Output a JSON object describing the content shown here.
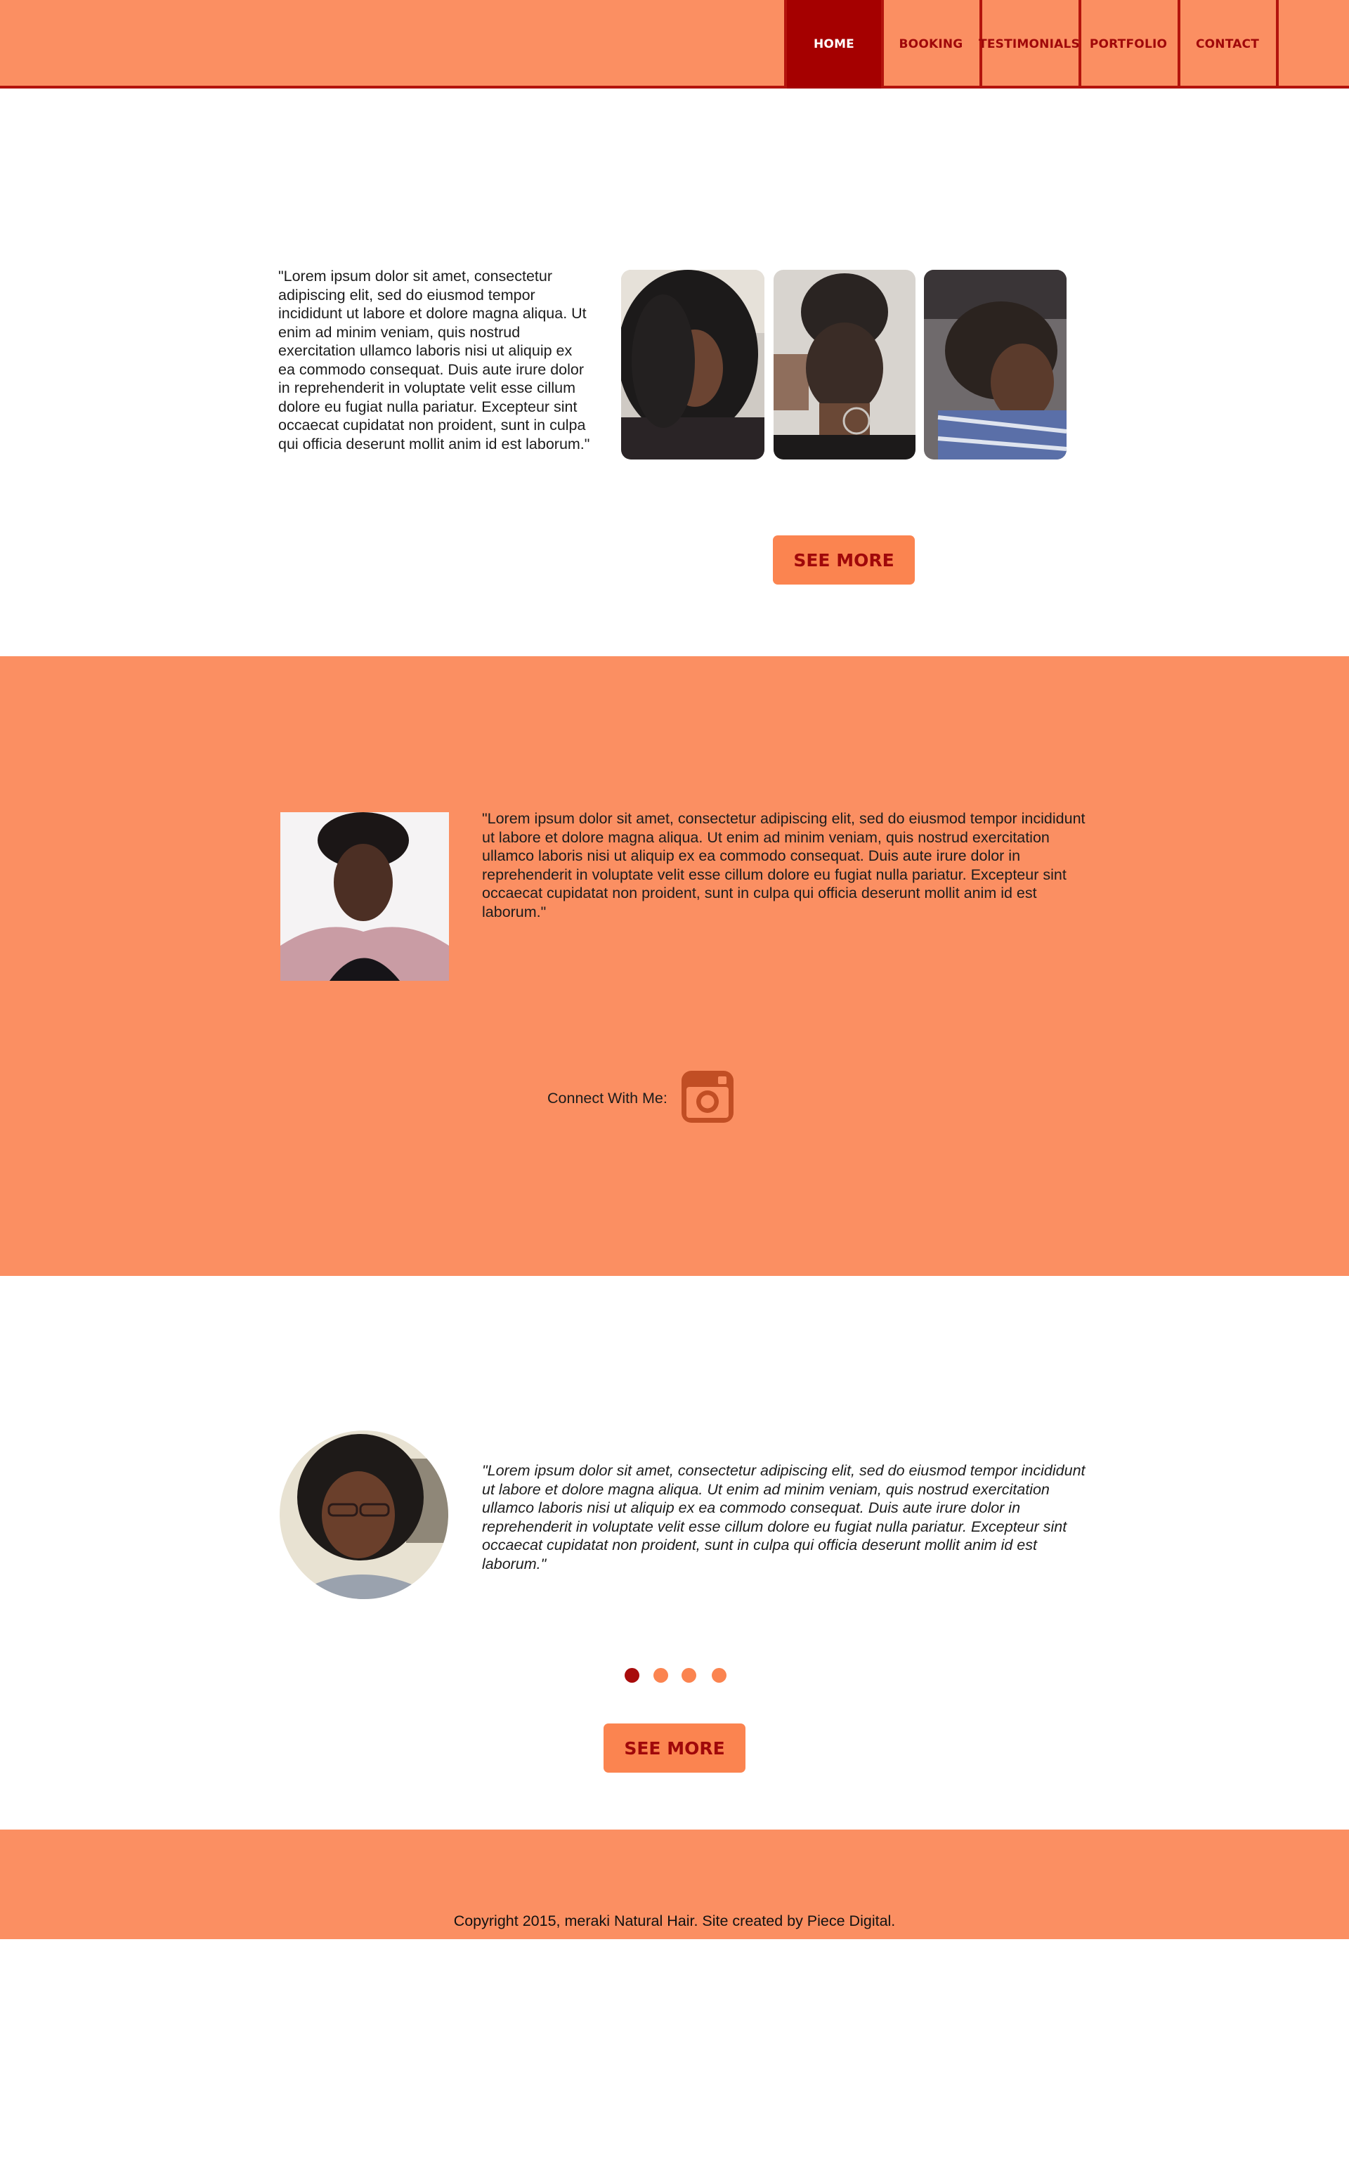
{
  "nav": {
    "items": [
      {
        "label": "HOME",
        "active": true
      },
      {
        "label": "BOOKING",
        "active": false
      },
      {
        "label": "TESTIMONIALS",
        "active": false
      },
      {
        "label": "PORTFOLIO",
        "active": false
      },
      {
        "label": "CONTACT",
        "active": false
      }
    ]
  },
  "intro": {
    "text": "\"Lorem ipsum dolor sit amet, consectetur adipiscing elit, sed do eiusmod tempor incididunt ut labore et dolore magna aliqua. Ut enim ad minim veniam, quis nostrud exercitation ullamco laboris nisi ut aliquip ex ea commodo consequat. Duis aute irure dolor in reprehenderit in voluptate velit esse cillum dolore eu fugiat nulla pariatur. Excepteur sint occaecat cupidatat non proident, sunt in culpa qui officia deserunt mollit anim id est laborum.\"",
    "see_more_label": "SEE MORE"
  },
  "about": {
    "text": "\"Lorem ipsum dolor sit amet, consectetur adipiscing elit, sed do eiusmod tempor incididunt ut labore et dolore magna aliqua. Ut enim ad minim veniam, quis nostrud exercitation ullamco laboris nisi ut aliquip ex ea commodo consequat. Duis aute irure dolor in reprehenderit in voluptate velit esse cillum dolore eu fugiat nulla pariatur. Excepteur sint occaecat cupidatat non proident, sunt in culpa qui officia deserunt mollit anim id est laborum.\"",
    "connect_label": "Connect With Me:",
    "social_icon": "instagram-icon"
  },
  "testimonial": {
    "text": "\"Lorem ipsum dolor sit amet, consectetur adipiscing elit, sed do eiusmod tempor incididunt ut labore et dolore magna aliqua. Ut enim ad minim veniam, quis nostrud exercitation ullamco laboris nisi ut aliquip ex ea commodo consequat. Duis aute irure dolor in reprehenderit in voluptate velit esse cillum dolore eu fugiat nulla pariatur. Excepteur sint occaecat cupidatat non proident, sunt in culpa qui officia deserunt mollit anim id est laborum.\"",
    "slide_count": 4,
    "active_slide": 1,
    "see_more_label": "SEE MORE"
  },
  "footer": {
    "copyright": "Copyright 2015, meraki Natural Hair. Site created by Piece Digital."
  },
  "colors": {
    "brand_orange": "#fb8f62",
    "button_orange": "#fb8450",
    "brand_red": "#a50000"
  }
}
